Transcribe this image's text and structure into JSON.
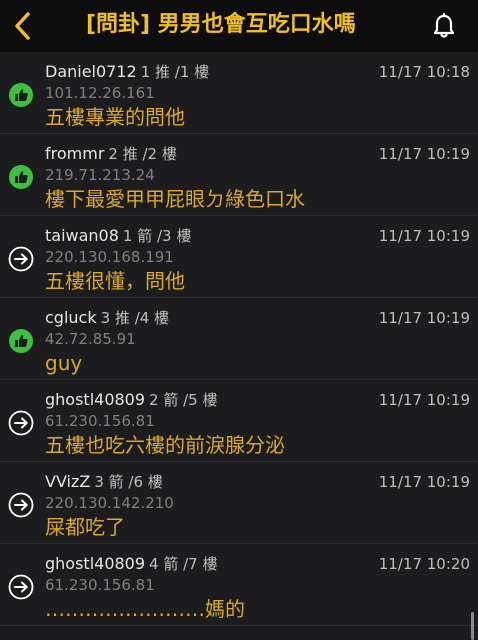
{
  "header": {
    "title": "[問卦] 男男也會互吃口水嗎",
    "back_icon": "chevron-left-icon",
    "bell_icon": "bell-icon",
    "accent_color": "#f0c020"
  },
  "comments": [
    {
      "author": "Daniel0712",
      "type": "推",
      "floor": "1 推 /1 樓",
      "time": "11/17 10:18",
      "ip": "101.12.26.161",
      "content": "五樓專業的問他",
      "icon": "thumbs-up-icon"
    },
    {
      "author": "frommr",
      "type": "推",
      "floor": "2 推 /2 樓",
      "time": "11/17 10:19",
      "ip": "219.71.213.24",
      "content": "樓下最愛甲甲屁眼ㄉ綠色口水",
      "icon": "thumbs-up-icon"
    },
    {
      "author": "taiwan08",
      "type": "箭",
      "floor": "1 箭 /3 樓",
      "time": "11/17 10:19",
      "ip": "220.130.168.191",
      "content": "五樓很懂，問他",
      "icon": "arrow-right-icon"
    },
    {
      "author": "cgluck",
      "type": "推",
      "floor": "3 推 /4 樓",
      "time": "11/17 10:19",
      "ip": "42.72.85.91",
      "content": "guy",
      "icon": "thumbs-up-icon"
    },
    {
      "author": "ghostl40809",
      "type": "箭",
      "floor": "2 箭 /5 樓",
      "time": "11/17 10:19",
      "ip": "61.230.156.81",
      "content": "五樓也吃六樓的前淚腺分泌",
      "icon": "arrow-right-icon"
    },
    {
      "author": "VVizZ",
      "type": "箭",
      "floor": "3 箭 /6 樓",
      "time": "11/17 10:19",
      "ip": "220.130.142.210",
      "content": "屎都吃了",
      "icon": "arrow-right-icon"
    },
    {
      "author": "ghostl40809",
      "type": "箭",
      "floor": "4 箭 /7 樓",
      "time": "11/17 10:20",
      "ip": "61.230.156.81",
      "content": "……………………媽的",
      "icon": "arrow-right-icon"
    }
  ],
  "colors": {
    "push": "#3fbf3f",
    "arrow": "#ffffff",
    "content": "#d9a826",
    "background": "#1c1c1e"
  }
}
